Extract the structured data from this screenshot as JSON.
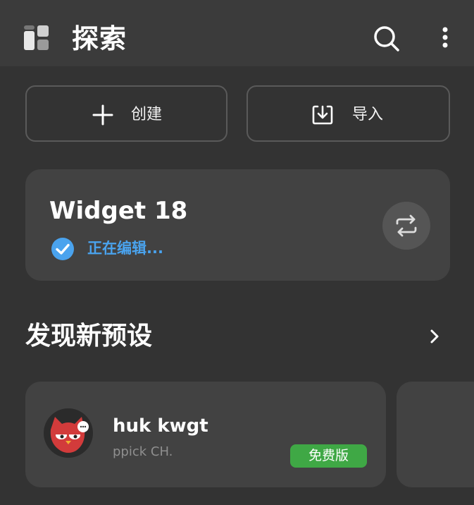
{
  "header": {
    "title": "探索",
    "app_icon": "dashboard-grid-icon",
    "search_icon": "search-icon",
    "more_icon": "more-vertical-icon"
  },
  "actions": {
    "create": {
      "label": "创建",
      "icon": "plus-icon"
    },
    "import": {
      "label": "导入",
      "icon": "import-tray-icon"
    }
  },
  "current_widget": {
    "name": "Widget 18",
    "status": "正在编辑...",
    "status_icon": "check-circle-icon",
    "swap_icon": "swap-arrows-icon"
  },
  "discover": {
    "title": "发现新预设",
    "more_icon": "chevron-right-icon",
    "presets": [
      {
        "name": "huk kwgt",
        "author": "ppick CH.",
        "badge": "免费版",
        "avatar": "red-owl-avatar"
      }
    ]
  },
  "colors": {
    "background": "#333333",
    "topbar": "#3b3b3b",
    "card": "#424242",
    "accent_blue": "#4aa3ee",
    "badge_green": "#3fa845"
  }
}
